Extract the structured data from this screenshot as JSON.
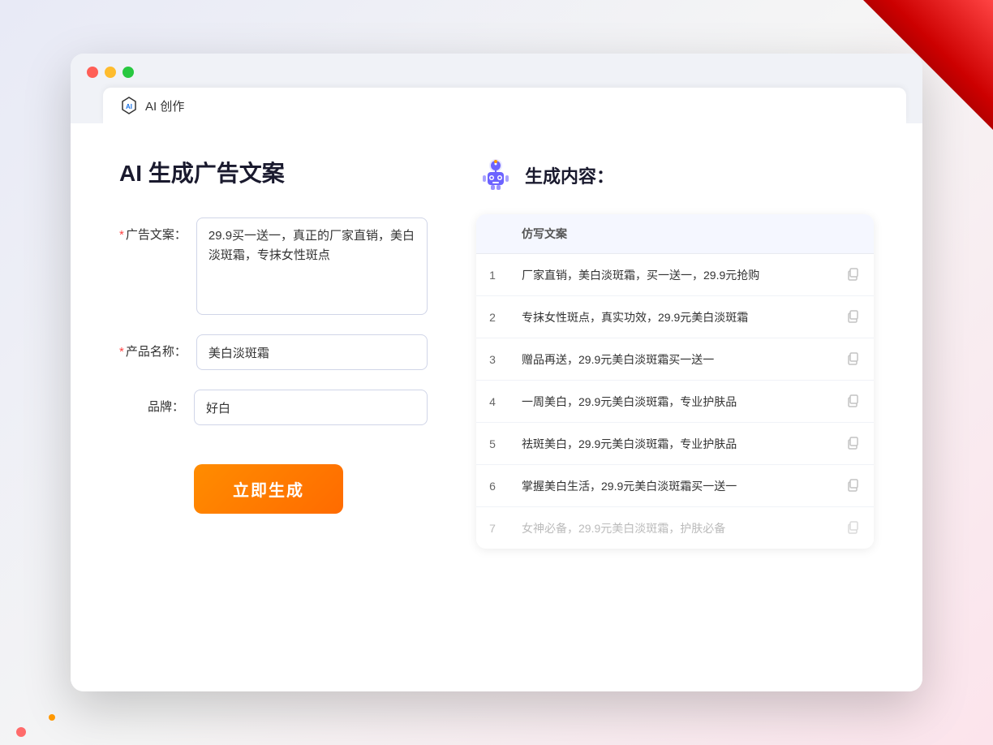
{
  "browser": {
    "tab_title": "AI 创作",
    "dot_colors": [
      "#ff5f57",
      "#febc2e",
      "#28c840"
    ]
  },
  "page": {
    "title": "AI 生成广告文案",
    "form": {
      "ad_copy_label": "广告文案：",
      "ad_copy_required": "*",
      "ad_copy_value": "29.9买一送一，真正的厂家直销，美白淡斑霜，专抹女性斑点",
      "product_name_label": "产品名称：",
      "product_name_required": "*",
      "product_name_value": "美白淡斑霜",
      "brand_label": "品牌：",
      "brand_value": "好白",
      "generate_button": "立即生成"
    },
    "result": {
      "header": "生成内容：",
      "table_col": "仿写文案",
      "items": [
        {
          "num": 1,
          "text": "厂家直销，美白淡斑霜，买一送一，29.9元抢购"
        },
        {
          "num": 2,
          "text": "专抹女性斑点，真实功效，29.9元美白淡斑霜"
        },
        {
          "num": 3,
          "text": "赠品再送，29.9元美白淡斑霜买一送一"
        },
        {
          "num": 4,
          "text": "一周美白，29.9元美白淡斑霜，专业护肤品"
        },
        {
          "num": 5,
          "text": "祛斑美白，29.9元美白淡斑霜，专业护肤品"
        },
        {
          "num": 6,
          "text": "掌握美白生活，29.9元美白淡斑霜买一送一"
        },
        {
          "num": 7,
          "text": "女神必备，29.9元美白淡斑霜，护肤必备",
          "faded": true
        }
      ]
    }
  }
}
